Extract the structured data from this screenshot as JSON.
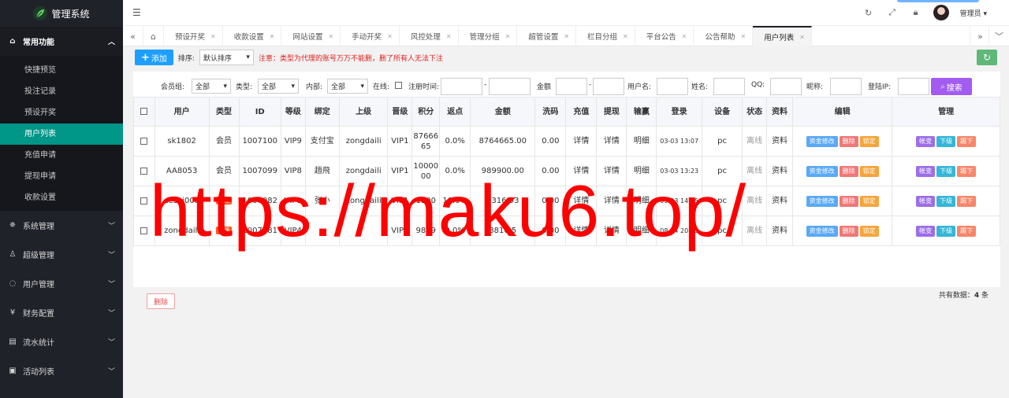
{
  "sidebar": {
    "brand": "管理系统",
    "groups": [
      {
        "label": "常用功能",
        "open": true,
        "items": [
          "快捷预览",
          "投注记录",
          "预设开奖",
          "用户列表",
          "充值申请",
          "提现申请",
          "收款设置"
        ],
        "active_item": "用户列表"
      },
      {
        "label": "系统管理"
      },
      {
        "label": "超级管理"
      },
      {
        "label": "用户管理"
      },
      {
        "label": "财务配置"
      },
      {
        "label": "流水统计"
      },
      {
        "label": "活动列表"
      }
    ]
  },
  "header": {
    "user_name": "管理员"
  },
  "tabs": [
    "预设开奖",
    "收款设置",
    "网站设置",
    "手动开奖",
    "风控处理",
    "管理分组",
    "超管设置",
    "栏目分组",
    "平台公告",
    "公告帮助",
    "用户列表"
  ],
  "active_tab": "用户列表",
  "toolbar": {
    "add_label": "添加",
    "sort_label": "排序:",
    "sort_value": "默认排序",
    "notice": "注意：类型为代理的账号万万不能删，删了所有人无法下注"
  },
  "filters": {
    "group_label": "会员组:",
    "group_value": "全部",
    "type_label": "类型:",
    "type_value": "全部",
    "internal_label": "内部:",
    "internal_value": "全部",
    "online_label": "在线:",
    "regtime_label": "注册时间:",
    "dash": "-",
    "amount_label": "金额",
    "username_label": "用户名:",
    "name_label": "姓名:",
    "qq_label": "QQ:",
    "nick_label": "昵称:",
    "ip_label": "登陆IP:",
    "search_label": "搜索"
  },
  "table": {
    "headers": [
      "用户",
      "类型",
      "ID",
      "等级",
      "绑定",
      "上级",
      "晋级",
      "积分",
      "返点",
      "金额",
      "洗码",
      "充值",
      "提现",
      "输赢",
      "登录",
      "设备",
      "状态",
      "资料",
      "编辑",
      "管理"
    ],
    "rows": [
      {
        "user": "sk1802",
        "type": "会员",
        "agent": false,
        "id": "1007100",
        "level": "VIP9",
        "bind": "支付宝",
        "parent": "zongdaili",
        "promote": "VIP1",
        "points": "8766665",
        "rebate": "0.0%",
        "amount": "8764665.00",
        "wash": "0.00",
        "recharge": "详情",
        "withdraw": "详情",
        "winloss": "明细",
        "login": "03-03 13:07",
        "device": "pc",
        "status": "离线",
        "profile": "资料"
      },
      {
        "user": "AA8053",
        "type": "会员",
        "agent": false,
        "id": "1007099",
        "level": "VIP8",
        "bind": "趙飛",
        "parent": "zongdaili",
        "promote": "VIP1",
        "points": "1000000",
        "rebate": "0.0%",
        "amount": "989900.00",
        "wash": "0.00",
        "recharge": "详情",
        "withdraw": "详情",
        "winloss": "明细",
        "login": "03-03 13:23",
        "device": "pc",
        "status": "离线",
        "profile": "资料"
      },
      {
        "user": "ceshi008",
        "type": "代理",
        "agent": true,
        "id": "1007082",
        "level": "VIP1",
        "bind": "张小",
        "parent": "zongdaili",
        "promote": "VIP1",
        "points": "1500",
        "rebate": "10.0%",
        "amount": "2316.93",
        "wash": "0.00",
        "recharge": "详情",
        "withdraw": "详情",
        "winloss": "明细",
        "login": "03-03 14:55",
        "device": "pc",
        "status": "离线",
        "profile": "资料"
      },
      {
        "user": "zongdaili",
        "type": "代理",
        "agent": true,
        "id": "1007081",
        "level": "VIP4",
        "bind": "",
        "parent": "",
        "promote": "VIP1",
        "points": "9899",
        "rebate": "0.0%",
        "amount": "8810.5",
        "wash": "0.00",
        "recharge": "详情",
        "withdraw": "详情",
        "winloss": "明细",
        "login": "08-04 20:55",
        "device": "pc",
        "status": "离线",
        "profile": "资料"
      }
    ],
    "edit_buttons": {
      "fund": "资金修改",
      "delete": "删除",
      "lock": "锁定"
    },
    "manage_buttons": {
      "account": "帐变",
      "down": "下级",
      "kick": "踢下"
    }
  },
  "footer": {
    "delete_label": "删除",
    "total_prefix": "共有数据：",
    "total_count": "4",
    "total_suffix": " 条"
  },
  "watermark": "https://maku6.top/",
  "colors": {
    "sidebar_bg": "#20222a",
    "active": "#009688",
    "primary": "#1e9fff",
    "danger": "#e02020",
    "search": "#a25cf0"
  }
}
